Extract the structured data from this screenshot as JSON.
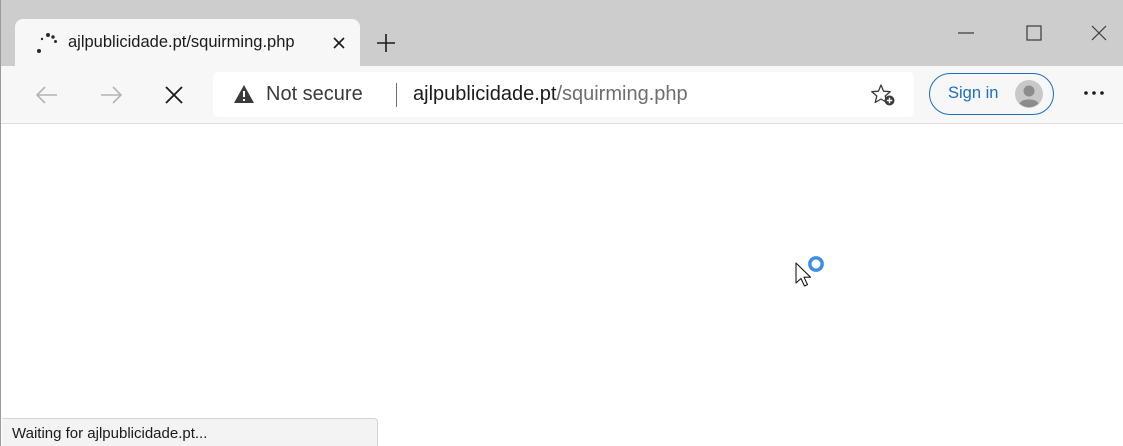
{
  "tab": {
    "title": "ajlpublicidade.pt/squirming.php",
    "spinner_icon": "loading-spinner-icon",
    "close_icon": "close-icon"
  },
  "new_tab_icon": "plus-icon",
  "window_controls": [
    "minimize-icon",
    "maximize-icon",
    "close-icon"
  ],
  "toolbar": {
    "back_icon": "arrow-left-icon",
    "forward_icon": "arrow-right-icon",
    "stop_icon": "close-icon"
  },
  "address_bar": {
    "security_label": "Not secure",
    "url_host": "ajlpublicidade.pt",
    "url_path": "/squirming.php",
    "warning_icon": "warning-triangle-icon",
    "favorite_icon": "add-favorite-star-icon"
  },
  "account": {
    "sign_in_label": "Sign in",
    "avatar_icon": "user-avatar-icon"
  },
  "more_icon": "ellipsis-icon",
  "status_bar": {
    "text": "Waiting for ajlpublicidade.pt..."
  },
  "colors": {
    "tabstrip": "#cdcdcd",
    "toolbar": "#f7f7f7",
    "accent": "#1b6fc1",
    "busy_cursor": "#3a8ee6"
  }
}
